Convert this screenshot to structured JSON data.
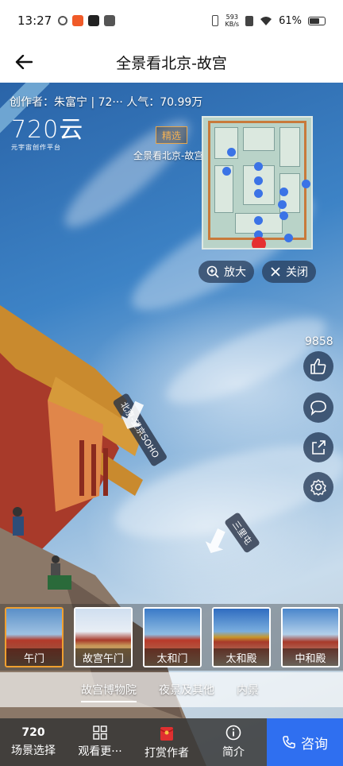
{
  "status_bar": {
    "time": "13:27",
    "net_speed_top": "593",
    "net_speed_bottom": "KB/s",
    "battery": "61%"
  },
  "header": {
    "title": "全景看北京-故宫",
    "back_icon": "arrow-left-icon"
  },
  "pano": {
    "author_line": "创作者：朱富宁 | 72···  人气：70.99万",
    "logo_big": "720云",
    "logo_small": "元宇宙创作平台",
    "featured_badge": "精选",
    "scene_caption": "全景看北京-故宫",
    "map_buttons": {
      "zoom": "放大",
      "close": "关闭"
    },
    "likes": "9858",
    "hotspots": [
      {
        "label": "北京-望京SOHO"
      },
      {
        "label": "三里屯"
      }
    ]
  },
  "scenes": [
    {
      "label": "午门",
      "active": true
    },
    {
      "label": "故宫午门",
      "active": false
    },
    {
      "label": "太和门",
      "active": false
    },
    {
      "label": "太和殿",
      "active": false
    },
    {
      "label": "中和殿",
      "active": false
    }
  ],
  "categories": [
    {
      "label": "故宫博物院",
      "active": true
    },
    {
      "label": "夜景及其他",
      "active": false
    },
    {
      "label": "内景",
      "active": false
    }
  ],
  "bottom_nav": {
    "scene_select_num": "720",
    "scene_select": "场景选择",
    "view_more": "观看更···",
    "tip_author": "打赏作者",
    "intro": "简介",
    "consult": "咨询"
  }
}
